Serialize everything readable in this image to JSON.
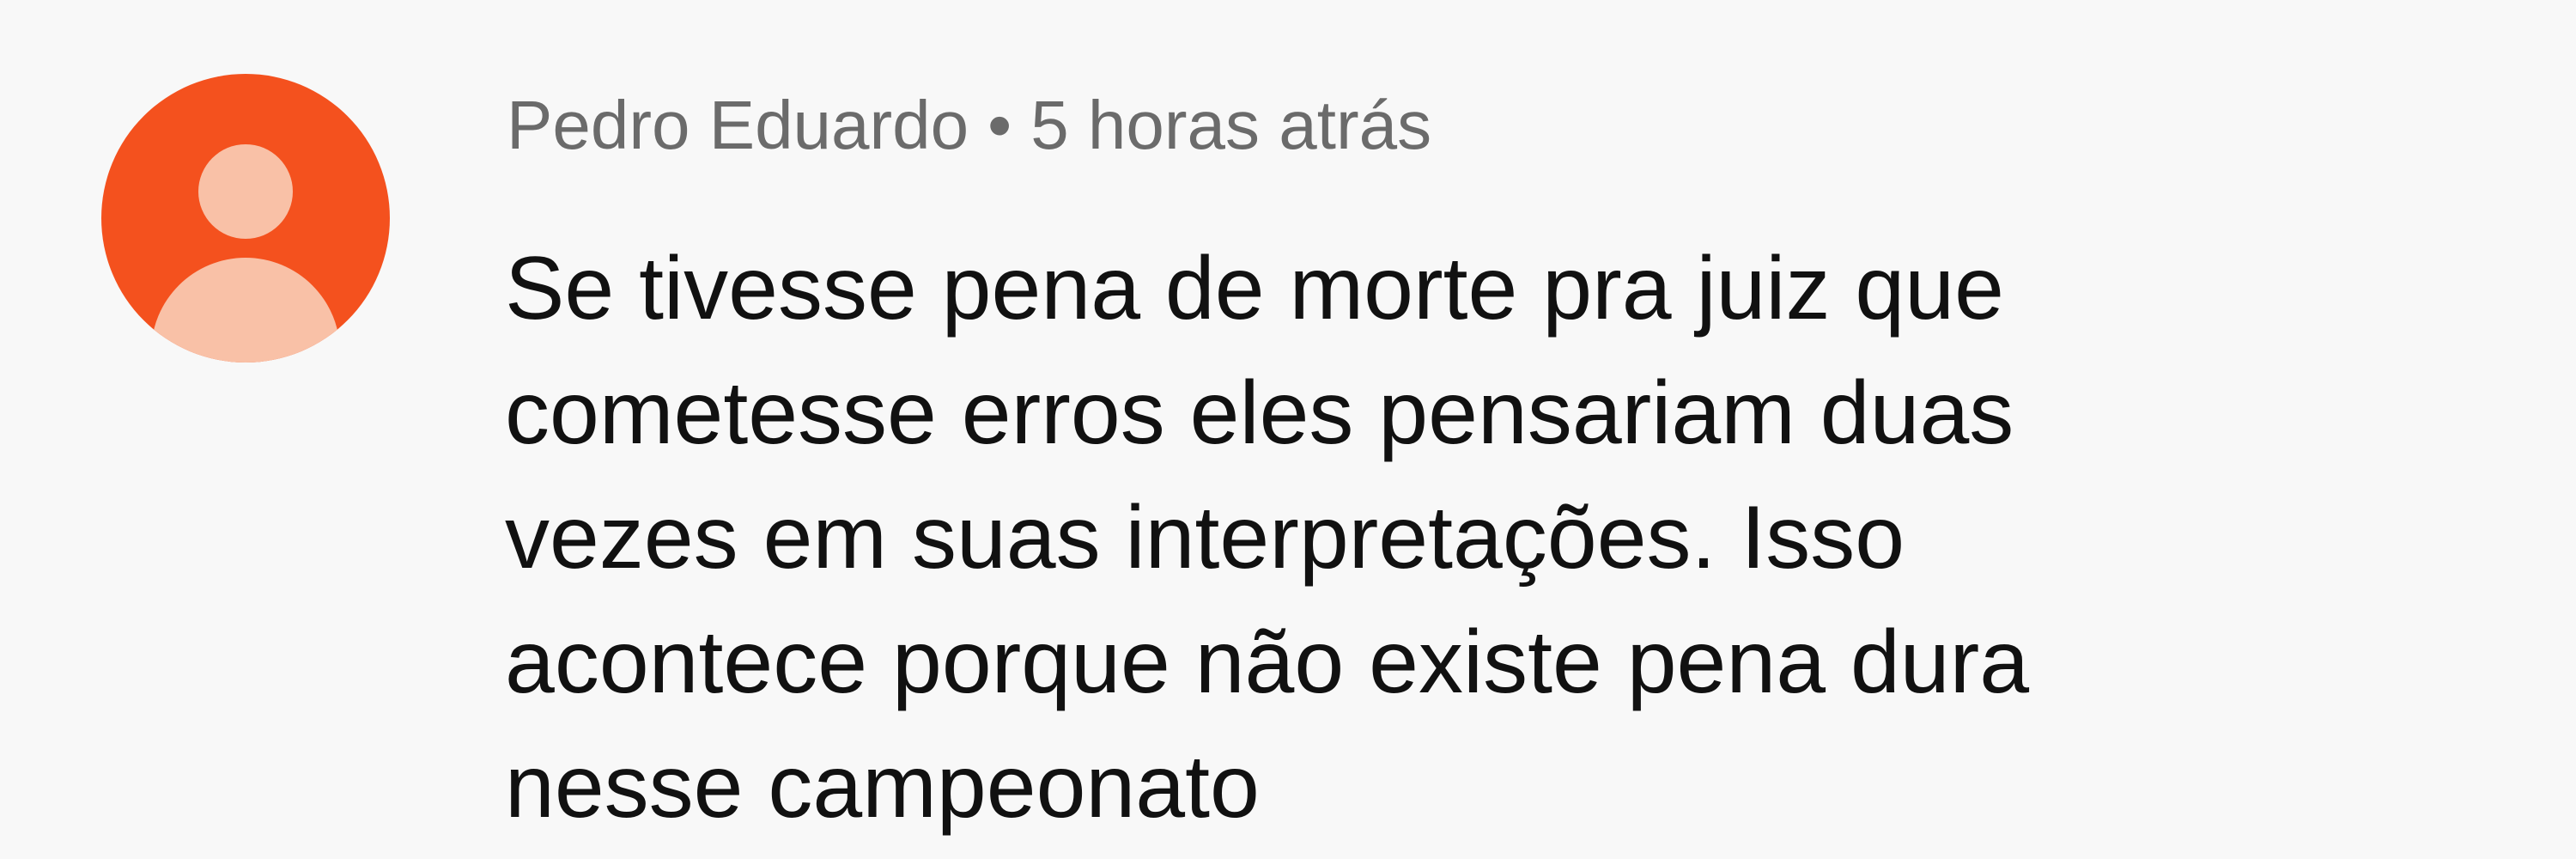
{
  "comment": {
    "author": "Pedro Eduardo",
    "separator": "•",
    "timestamp": "5 horas atrás",
    "text_lines": [
      "Se tivesse pena de morte pra juiz que",
      "cometesse erros eles pensariam duas",
      "vezes em suas interpretações. Isso",
      "acontece porque não existe pena dura",
      "nesse campeonato"
    ],
    "avatar": {
      "icon": "default-user-icon",
      "background_color": "#f4511e",
      "figure_color": "#f9c1a7"
    }
  }
}
